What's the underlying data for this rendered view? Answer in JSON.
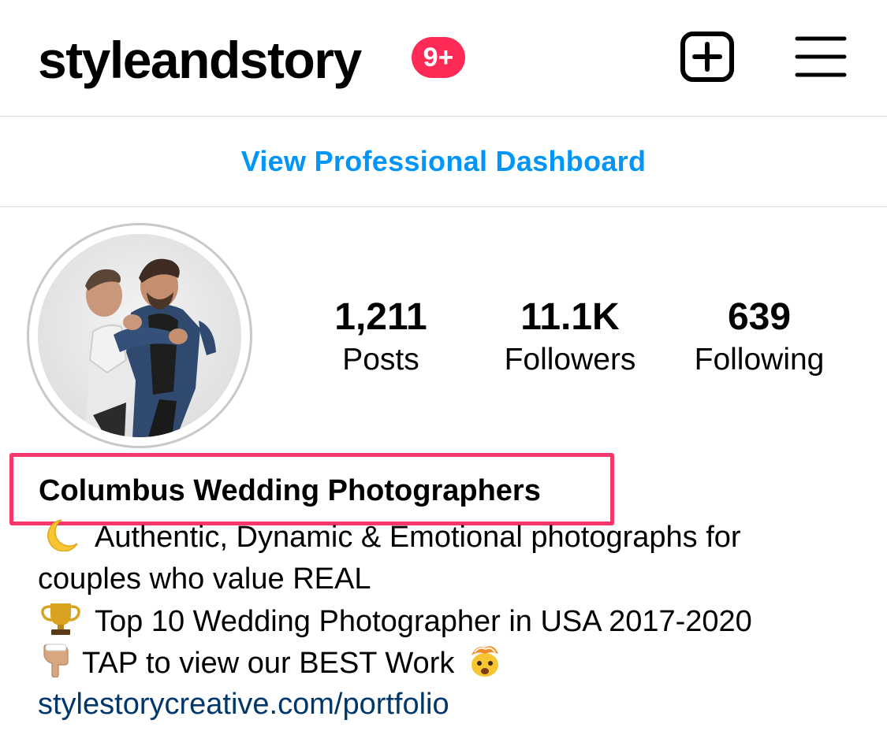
{
  "header": {
    "username": "styleandstory",
    "notification_badge": "9+",
    "badge_color": "#fd2b55"
  },
  "dashboard": {
    "label": "View Professional Dashboard",
    "color": "#0095f6"
  },
  "stats": [
    {
      "value": "1,211",
      "label": "Posts"
    },
    {
      "value": "11.1K",
      "label": "Followers"
    },
    {
      "value": "639",
      "label": "Following"
    }
  ],
  "bio": {
    "name": "Columbus Wedding Photographers",
    "highlight_color": "#f4386c",
    "lines": [
      {
        "emoji": "crescent-moon",
        "text": "Authentic, Dynamic & Emotional photographs for"
      },
      {
        "emoji": "",
        "text": "couples who value REAL"
      },
      {
        "emoji": "trophy",
        "text": "Top 10 Wedding Photographer in USA 2017-2020"
      },
      {
        "emoji": "pointing-down",
        "text": "TAP to view our BEST Work",
        "trailing_emoji": "exploding-head"
      }
    ],
    "link": "stylestorycreative.com/portfolio",
    "link_color": "#00376b"
  },
  "icons": {
    "new_post": "plus-square-icon",
    "menu": "hamburger-menu-icon"
  }
}
